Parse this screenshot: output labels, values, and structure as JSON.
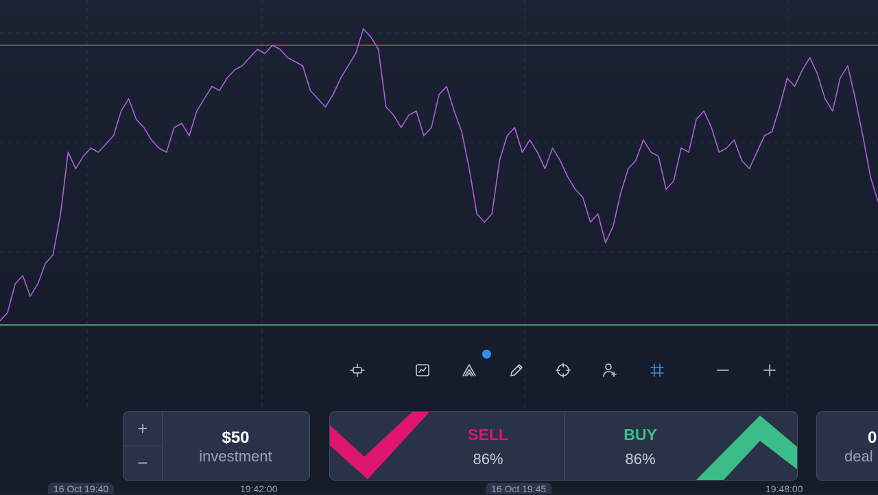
{
  "chart_data": {
    "type": "line",
    "series": [
      {
        "values": [
          29.4,
          29.8,
          31.2,
          31.6,
          30.6,
          31.2,
          32.2,
          32.6,
          34.6,
          37.6,
          36.8,
          37.4,
          37.8,
          37.6,
          38.0,
          38.4,
          39.6,
          40.2,
          39.2,
          38.8,
          38.2,
          37.8,
          37.6,
          38.8,
          39.0,
          38.4,
          39.6,
          40.2,
          40.8,
          40.6,
          41.2,
          41.6,
          41.8,
          42.2,
          42.6,
          42.4,
          42.8,
          42.6,
          42.2,
          42.0,
          41.8,
          40.6,
          40.2,
          39.8,
          40.4,
          41.2,
          41.8,
          42.4,
          43.6,
          43.2,
          42.6,
          39.8,
          39.4,
          38.8,
          39.4,
          39.6,
          38.4,
          38.8,
          40.4,
          40.8,
          39.6,
          38.6,
          36.8,
          34.6,
          34.2,
          34.6,
          37.2,
          38.4,
          38.8,
          37.6,
          38.2,
          37.6,
          36.8,
          37.8,
          37.2,
          36.4,
          35.8,
          35.4,
          34.2,
          34.6,
          33.2,
          34.0,
          35.6,
          36.8,
          37.2,
          38.2,
          37.6,
          37.4,
          35.8,
          36.2,
          37.8,
          37.6,
          39.2,
          39.6,
          38.8,
          37.6,
          37.8,
          38.2,
          37.2,
          36.8,
          37.6,
          38.4,
          38.6,
          39.8,
          41.2,
          40.8,
          41.6,
          42.2,
          41.4,
          40.2,
          39.6,
          41.2,
          41.8,
          40.2,
          38.4,
          36.4,
          35.2
        ]
      }
    ],
    "levels": [
      {
        "color": "#e0516a",
        "value": 42.8
      },
      {
        "color": "#6ee07a",
        "value": 29.2
      }
    ],
    "ylim": [
      25,
      45
    ],
    "x_ticks": [
      "16 Oct 19:40",
      "19:42:00",
      "16 Oct 19:45",
      "19:48:00"
    ],
    "grid": true,
    "line_color": "#b060d8"
  },
  "toolbar": {
    "tools": [
      {
        "name": "chart-type-icon"
      },
      {
        "name": "indicators-icon"
      },
      {
        "name": "drawing-tools-icon"
      },
      {
        "name": "pencil-icon"
      },
      {
        "name": "crosshair-icon"
      },
      {
        "name": "social-trading-icon"
      },
      {
        "name": "grid-icon"
      },
      {
        "name": "zoom-out-icon"
      },
      {
        "name": "zoom-in-icon"
      }
    ],
    "accent": "#3a8ee6"
  },
  "investment": {
    "plus": "+",
    "minus": "−",
    "amount": "$50",
    "label": "investment"
  },
  "trade": {
    "sell_label": "SELL",
    "sell_pct": "86%",
    "buy_label": "BUY",
    "buy_pct": "86%",
    "sell_color": "#e0156f",
    "buy_color": "#3bbd8a"
  },
  "deal": {
    "value": "0",
    "label": "deal"
  }
}
